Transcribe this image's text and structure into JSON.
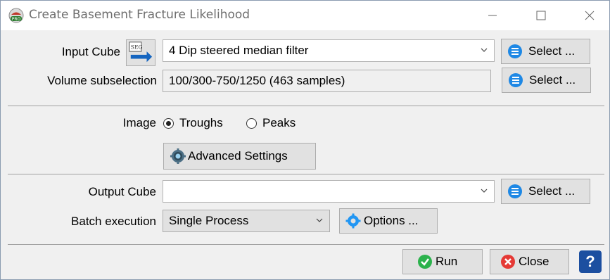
{
  "window": {
    "title": "Create Basement Fracture Likelihood",
    "app_icon": "opendtect-pro-icon",
    "controls": [
      "minimize-icon",
      "maximize-icon",
      "close-icon"
    ]
  },
  "input": {
    "label": "Input Cube",
    "value": "4 Dip steered median filter",
    "select_label": "Select ..."
  },
  "subselection": {
    "label": "Volume subselection",
    "value": "100/300-750/1250 (463 samples)",
    "select_label": "Select ..."
  },
  "image": {
    "label": "Image",
    "options": [
      "Troughs",
      "Peaks"
    ],
    "selected": "Troughs",
    "advanced_label": "Advanced Settings"
  },
  "output": {
    "label": "Output Cube",
    "value": "",
    "select_label": "Select ..."
  },
  "batch": {
    "label": "Batch execution",
    "value": "Single Process",
    "options_label": "Options ..."
  },
  "footer": {
    "run_label": "Run",
    "close_label": "Close",
    "help_label": "?"
  },
  "colors": {
    "select_icon": "#1e88e5",
    "run_icon": "#2bb24c",
    "close_icon": "#e53935",
    "help_bg": "#1c4fa0"
  }
}
